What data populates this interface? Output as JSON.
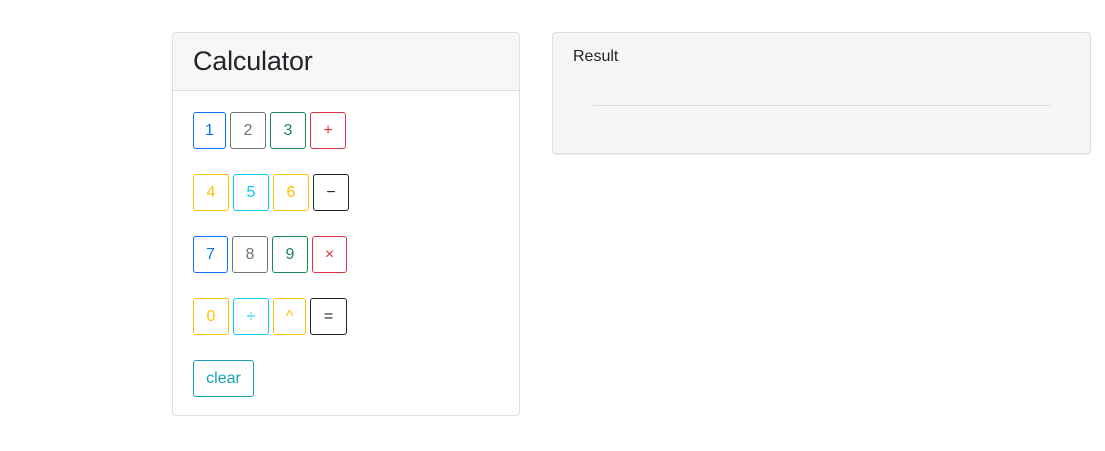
{
  "calculator": {
    "title": "Calculator",
    "buttons": [
      {
        "label": "1",
        "color": "#0d6efd"
      },
      {
        "label": "2",
        "color": "#6c757d"
      },
      {
        "label": "3",
        "color": "#198754"
      },
      {
        "label": "+",
        "color": "#dc3545"
      },
      {
        "label": "4",
        "color": "#ffc107"
      },
      {
        "label": "5",
        "color": "#0dcaf0"
      },
      {
        "label": "6",
        "color": "#ffc107"
      },
      {
        "label": "−",
        "color": "#212529"
      },
      {
        "label": "7",
        "color": "#0d6efd"
      },
      {
        "label": "8",
        "color": "#6c757d"
      },
      {
        "label": "9",
        "color": "#198754"
      },
      {
        "label": "×",
        "color": "#dc3545"
      },
      {
        "label": "0",
        "color": "#ffc107"
      },
      {
        "label": "÷",
        "color": "#0dcaf0"
      },
      {
        "label": "^",
        "color": "#ffc107"
      },
      {
        "label": "=",
        "color": "#212529"
      },
      {
        "label": "clear",
        "color": "#17a2b8"
      }
    ]
  },
  "result": {
    "label": "Result",
    "value": ""
  }
}
